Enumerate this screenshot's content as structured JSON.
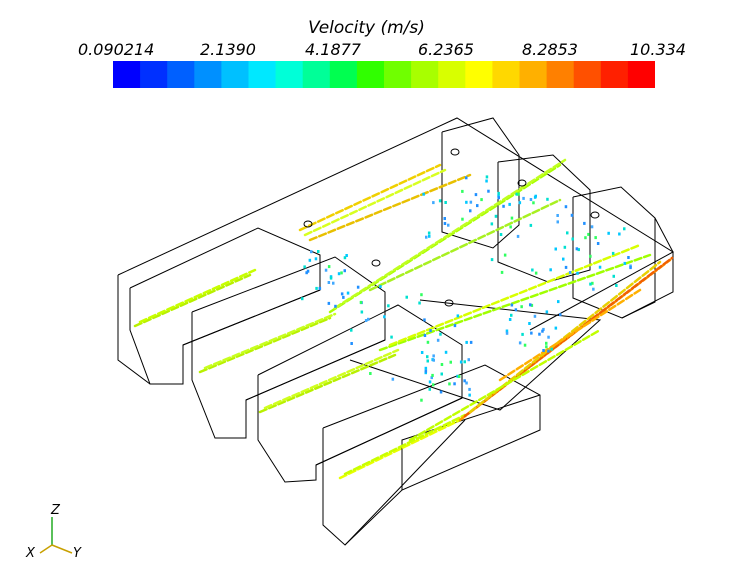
{
  "legend": {
    "title": "Velocity (m/s)",
    "ticks": [
      "0.090214",
      "2.1390",
      "4.1877",
      "6.2365",
      "8.2853",
      "10.334"
    ],
    "colors": [
      "#0000ff",
      "#0030ff",
      "#0060ff",
      "#0090ff",
      "#00c0ff",
      "#00e8ff",
      "#00ffd8",
      "#00ff98",
      "#00ff50",
      "#30ff00",
      "#70ff00",
      "#a8ff00",
      "#d8ff00",
      "#ffff00",
      "#ffd800",
      "#ffb000",
      "#ff8000",
      "#ff5000",
      "#ff2000",
      "#ff0000"
    ]
  },
  "axes": {
    "x": "X",
    "y": "Y",
    "z": "Z"
  }
}
